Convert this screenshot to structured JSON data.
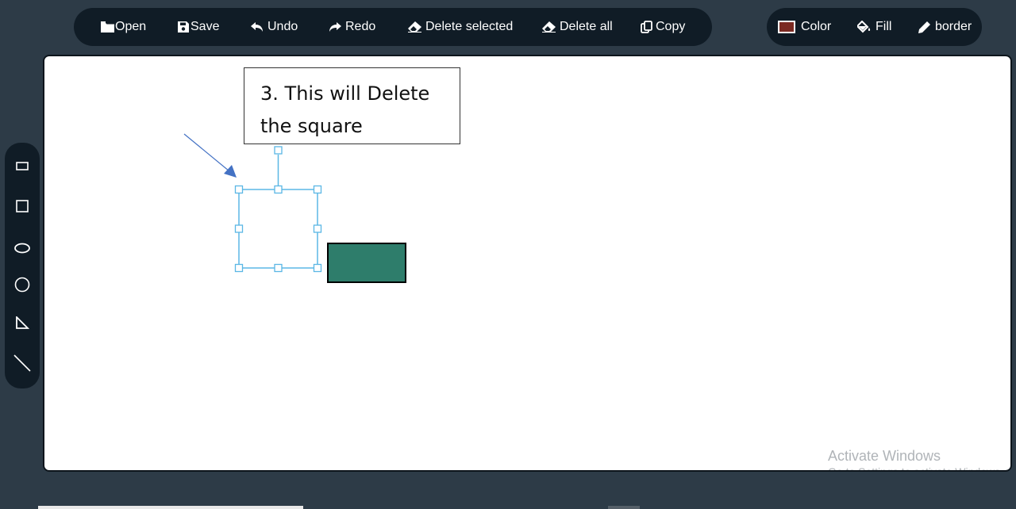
{
  "toolbar": {
    "open": {
      "label": "Open",
      "icon": "folder-icon"
    },
    "save": {
      "label": "Save",
      "icon": "floppy-icon"
    },
    "undo": {
      "label": "Undo",
      "icon": "undo-icon"
    },
    "redo": {
      "label": "Redo",
      "icon": "redo-icon"
    },
    "delete_selected": {
      "label": "Delete selected",
      "icon": "eraser-icon"
    },
    "delete_all": {
      "label": "Delete all",
      "icon": "eraser-icon"
    },
    "copy": {
      "label": "Copy",
      "icon": "copy-icon"
    }
  },
  "style_toolbar": {
    "color": {
      "label": "Color",
      "icon": "color-swatch",
      "value": "#7b2a22"
    },
    "fill": {
      "label": "Fill",
      "icon": "paint-bucket-icon"
    },
    "border": {
      "label": "border",
      "icon": "pencil-icon"
    }
  },
  "shape_tools": [
    {
      "name": "rectangle",
      "icon": "rectangle-icon"
    },
    {
      "name": "square",
      "icon": "square-icon"
    },
    {
      "name": "ellipse",
      "icon": "ellipse-icon"
    },
    {
      "name": "circle",
      "icon": "circle-icon"
    },
    {
      "name": "triangle",
      "icon": "right-triangle-icon"
    },
    {
      "name": "line",
      "icon": "line-icon"
    }
  ],
  "annotation": {
    "line1": "3. This will Delete",
    "line2": "the square"
  },
  "canvas": {
    "selection_color": "#5bb7e5",
    "rect_fill": "#2e7d6b",
    "arrow_color": "#4472c4"
  },
  "watermark": {
    "title": "Activate Windows",
    "subtitle": "Go to Settings to activate Windows."
  }
}
